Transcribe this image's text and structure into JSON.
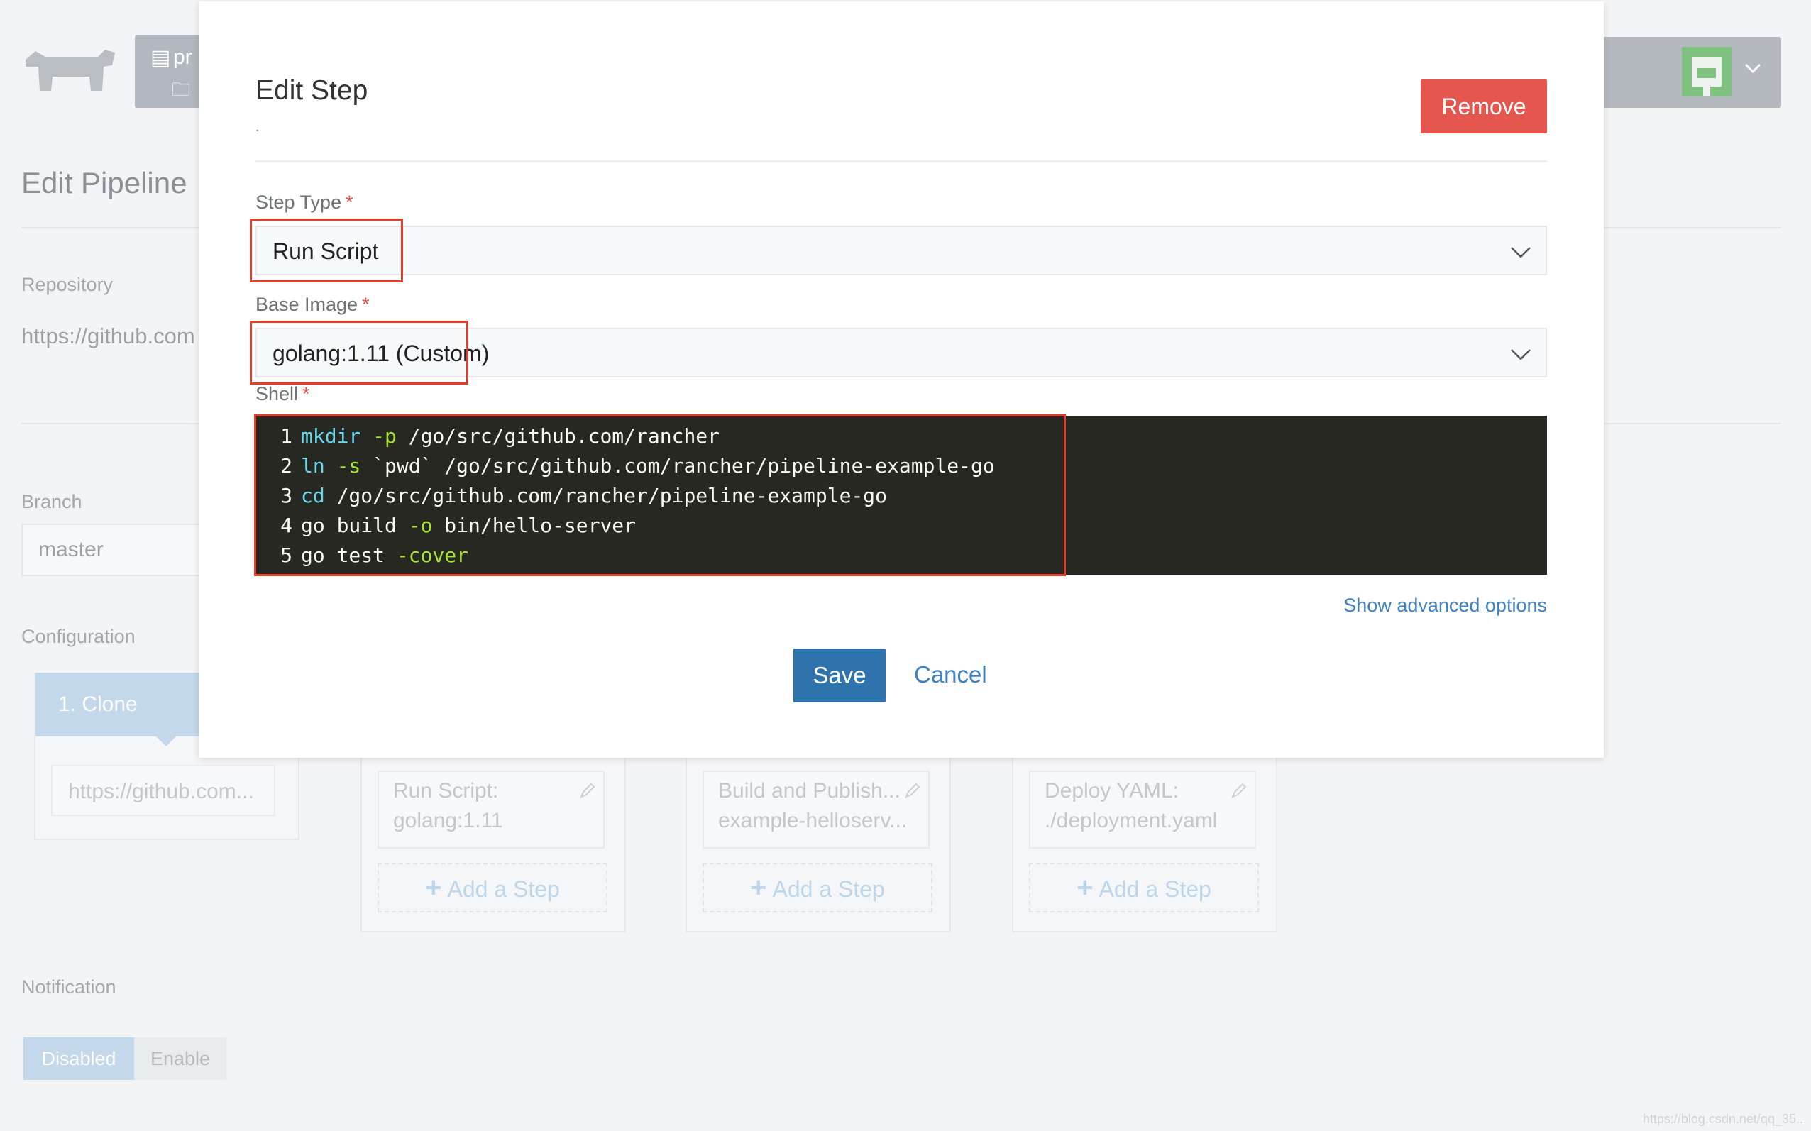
{
  "background": {
    "env_tab": {
      "line1_icon": "server-icon",
      "line1_text": "pr",
      "line2_icon": "folder-icon"
    },
    "page_title": "Edit Pipeline",
    "repository_label": "Repository",
    "repository_value": "https://github.com",
    "branch_label": "Branch",
    "branch_value": "master",
    "configuration_label": "Configuration",
    "stages": {
      "clone": {
        "title": "1. Clone",
        "step": "https://github.com..."
      },
      "stage2": {
        "step_line1": "Run Script:",
        "step_line2": "golang:1.11",
        "add": "Add a Step"
      },
      "stage3": {
        "step_line1": "Build and Publish...",
        "step_line2": "example-helloserv...",
        "add": "Add a Step"
      },
      "stage4": {
        "step_line1": "Deploy YAML:",
        "step_line2": "./deployment.yaml",
        "add": "Add a Step"
      }
    },
    "notification_label": "Notification",
    "notification_disabled": "Disabled",
    "notification_enable": "Enable",
    "watermark": "https://blog.csdn.net/qq_35..."
  },
  "modal": {
    "title": "Edit Step",
    "subtitle": ".",
    "remove_label": "Remove",
    "step_type_label": "Step Type",
    "step_type_value": "Run Script",
    "base_image_label": "Base Image",
    "base_image_value": "golang:1.11 (Custom)",
    "shell_label": "Shell",
    "required_mark": "*",
    "shell_lines": [
      {
        "n": "1",
        "a": "mkdir",
        "b": " -p",
        "c": " /go/src/github.com/rancher"
      },
      {
        "n": "2",
        "a": "ln",
        "b": " -s",
        "c": " `pwd` /go/src/github.com/rancher/pipeline-example-go"
      },
      {
        "n": "3",
        "a": "cd",
        "b": "",
        "c": " /go/src/github.com/rancher/pipeline-example-go"
      },
      {
        "n": "4",
        "a": "go build",
        "b": " -o",
        "c": " bin/hello-server"
      },
      {
        "n": "5",
        "a": "go test",
        "b": " -cover",
        "c": ""
      }
    ],
    "advanced_label": "Show advanced options",
    "save_label": "Save",
    "cancel_label": "Cancel"
  },
  "colors": {
    "accent_blue": "#2f73ad",
    "danger_red": "#e5564f",
    "highlight_red": "#e0402a",
    "editor_bg": "#272822"
  }
}
